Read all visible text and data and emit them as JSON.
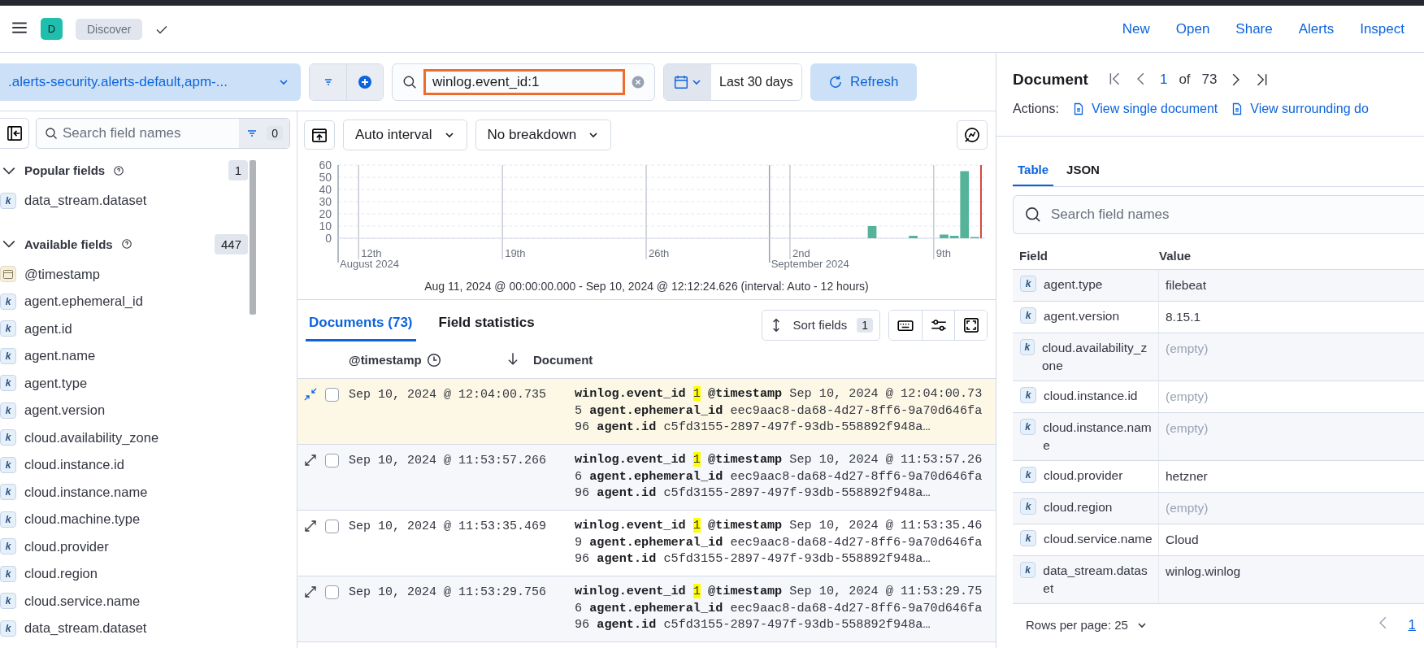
{
  "header": {
    "avatar": "D",
    "app": "Discover",
    "links": [
      "New",
      "Open",
      "Share",
      "Alerts",
      "Inspect"
    ]
  },
  "query_bar": {
    "data_view": ".alerts-security.alerts-default,apm-...",
    "query": "winlog.event_id:1",
    "date_range": "Last 30 days",
    "refresh": "Refresh"
  },
  "sidebar": {
    "search_placeholder": "Search field names",
    "filter_count": "0",
    "sections": [
      {
        "title": "Popular fields",
        "count": "1",
        "expanded": true,
        "fields": [
          {
            "kind": "keyword",
            "badge": "k",
            "name": "data_stream.dataset"
          }
        ]
      },
      {
        "title": "Available fields",
        "count": "447",
        "expanded": true,
        "fields": [
          {
            "kind": "date",
            "name": "@timestamp"
          },
          {
            "kind": "keyword",
            "badge": "k",
            "name": "agent.ephemeral_id"
          },
          {
            "kind": "keyword",
            "badge": "k",
            "name": "agent.id"
          },
          {
            "kind": "keyword",
            "badge": "k",
            "name": "agent.name"
          },
          {
            "kind": "keyword",
            "badge": "k",
            "name": "agent.type"
          },
          {
            "kind": "keyword",
            "badge": "k",
            "name": "agent.version"
          },
          {
            "kind": "keyword",
            "badge": "k",
            "name": "cloud.availability_zone"
          },
          {
            "kind": "keyword",
            "badge": "k",
            "name": "cloud.instance.id"
          },
          {
            "kind": "keyword",
            "badge": "k",
            "name": "cloud.instance.name"
          },
          {
            "kind": "keyword",
            "badge": "k",
            "name": "cloud.machine.type"
          },
          {
            "kind": "keyword",
            "badge": "k",
            "name": "cloud.provider"
          },
          {
            "kind": "keyword",
            "badge": "k",
            "name": "cloud.region"
          },
          {
            "kind": "keyword",
            "badge": "k",
            "name": "cloud.service.name"
          },
          {
            "kind": "keyword",
            "badge": "k",
            "name": "data_stream.dataset"
          }
        ]
      }
    ]
  },
  "chart_toolbar": {
    "interval": "Auto interval",
    "breakdown": "No breakdown"
  },
  "histogram": {
    "chart_data": {
      "type": "bar",
      "categories": [
        null,
        null,
        "12th",
        null,
        null,
        null,
        null,
        null,
        null,
        null,
        null,
        null,
        null,
        null,
        null,
        null,
        "19th",
        null,
        null,
        null,
        null,
        null,
        null,
        null,
        null,
        null,
        null,
        null,
        null,
        null,
        "26th",
        null,
        null,
        null,
        null,
        null,
        null,
        null,
        null,
        null,
        null,
        null,
        null,
        null,
        "2nd",
        null,
        null,
        null,
        null,
        null,
        null,
        null,
        null,
        null,
        null,
        null,
        null,
        null,
        "9th",
        null,
        null,
        null
      ],
      "values": [
        0,
        0,
        0,
        0,
        0,
        0,
        0,
        0,
        0,
        0,
        0,
        0,
        0,
        0,
        0,
        0,
        0,
        0,
        0,
        0,
        0,
        0,
        0,
        0,
        0,
        0,
        0,
        0,
        0,
        0,
        0,
        0,
        0,
        0,
        0,
        0,
        0,
        0,
        0,
        0,
        0,
        0,
        0,
        0,
        0,
        0,
        0,
        0,
        0,
        0,
        0,
        10,
        0,
        0,
        0,
        2,
        0,
        0,
        3,
        2,
        55,
        1
      ],
      "ylim": [
        0,
        60
      ],
      "yticks": [
        0,
        10,
        20,
        30,
        40,
        50,
        60
      ],
      "grid": true,
      "annotations": [
        "August 2024",
        "September 2024"
      ]
    },
    "time_range": "Aug 11, 2024 @ 00:00:00.000 - Sep 10, 2024 @ 12:12:24.626 (interval: Auto - 12 hours)"
  },
  "tabs": [
    {
      "label": "Documents (73)",
      "selected": true
    },
    {
      "label": "Field statistics",
      "selected": false
    }
  ],
  "sort_fields": {
    "label": "Sort fields",
    "count": "1"
  },
  "table": {
    "columns": [
      "@timestamp",
      "Document"
    ],
    "rows": [
      {
        "selected": true,
        "timestamp": "Sep 10, 2024 @ 12:04:00.735",
        "fields": [
          {
            "name": "winlog.event_id",
            "value": "1",
            "highlight": true
          },
          {
            "name": "@timestamp",
            "value": "Sep 10, 2024 @ 12:04:00.735",
            "highlight": false
          },
          {
            "name": "agent.ephemeral_id",
            "value": "eec9aac8-da68-4d27-8ff6-9a70d646fa96",
            "highlight": false
          },
          {
            "name": "agent.id",
            "value": "c5fd3155-2897-497f-93db-558892f948a…",
            "highlight": false
          }
        ]
      },
      {
        "selected": false,
        "timestamp": "Sep 10, 2024 @ 11:53:57.266",
        "fields": [
          {
            "name": "winlog.event_id",
            "value": "1",
            "highlight": true
          },
          {
            "name": "@timestamp",
            "value": "Sep 10, 2024 @ 11:53:57.266",
            "highlight": false
          },
          {
            "name": "agent.ephemeral_id",
            "value": "eec9aac8-da68-4d27-8ff6-9a70d646fa96",
            "highlight": false
          },
          {
            "name": "agent.id",
            "value": "c5fd3155-2897-497f-93db-558892f948a…",
            "highlight": false
          }
        ]
      },
      {
        "selected": false,
        "timestamp": "Sep 10, 2024 @ 11:53:35.469",
        "fields": [
          {
            "name": "winlog.event_id",
            "value": "1",
            "highlight": true
          },
          {
            "name": "@timestamp",
            "value": "Sep 10, 2024 @ 11:53:35.469",
            "highlight": false
          },
          {
            "name": "agent.ephemeral_id",
            "value": "eec9aac8-da68-4d27-8ff6-9a70d646fa96",
            "highlight": false
          },
          {
            "name": "agent.id",
            "value": "c5fd3155-2897-497f-93db-558892f948a…",
            "highlight": false
          }
        ]
      },
      {
        "selected": false,
        "timestamp": "Sep 10, 2024 @ 11:53:29.756",
        "fields": [
          {
            "name": "winlog.event_id",
            "value": "1",
            "highlight": true
          },
          {
            "name": "@timestamp",
            "value": "Sep 10, 2024 @ 11:53:29.756",
            "highlight": false
          },
          {
            "name": "agent.ephemeral_id",
            "value": "eec9aac8-da68-4d27-8ff6-9a70d646fa96",
            "highlight": false
          },
          {
            "name": "agent.id",
            "value": "c5fd3155-2897-497f-93db-558892f948a…",
            "highlight": false
          }
        ]
      }
    ]
  },
  "document_panel": {
    "title": "Document",
    "page": "1",
    "of": "of",
    "total": "73",
    "actions_label": "Actions:",
    "actions": [
      "View single document",
      "View surrounding do"
    ],
    "tabs": [
      {
        "label": "Table",
        "selected": true
      },
      {
        "label": "JSON",
        "selected": false
      }
    ],
    "search_placeholder": "Search field names",
    "columns": [
      "Field",
      "Value"
    ],
    "rows": [
      {
        "badge": "k",
        "field": "agent.type",
        "value": "filebeat",
        "empty": false
      },
      {
        "badge": "k",
        "field": "agent.version",
        "value": "8.15.1",
        "empty": false
      },
      {
        "badge": "k",
        "field": "cloud.availability_zone",
        "value": "(empty)",
        "empty": true
      },
      {
        "badge": "k",
        "field": "cloud.instance.id",
        "value": "(empty)",
        "empty": true
      },
      {
        "badge": "k",
        "field": "cloud.instance.name",
        "value": "(empty)",
        "empty": true
      },
      {
        "badge": "k",
        "field": "cloud.provider",
        "value": "hetzner",
        "empty": false
      },
      {
        "badge": "k",
        "field": "cloud.region",
        "value": "(empty)",
        "empty": true
      },
      {
        "badge": "k",
        "field": "cloud.service.name",
        "value": "Cloud",
        "empty": false
      },
      {
        "badge": "k",
        "field": "data_stream.dataset",
        "value": "winlog.winlog",
        "empty": false
      }
    ],
    "rows_per_page": "Rows per page: 25",
    "page_link": "1"
  }
}
